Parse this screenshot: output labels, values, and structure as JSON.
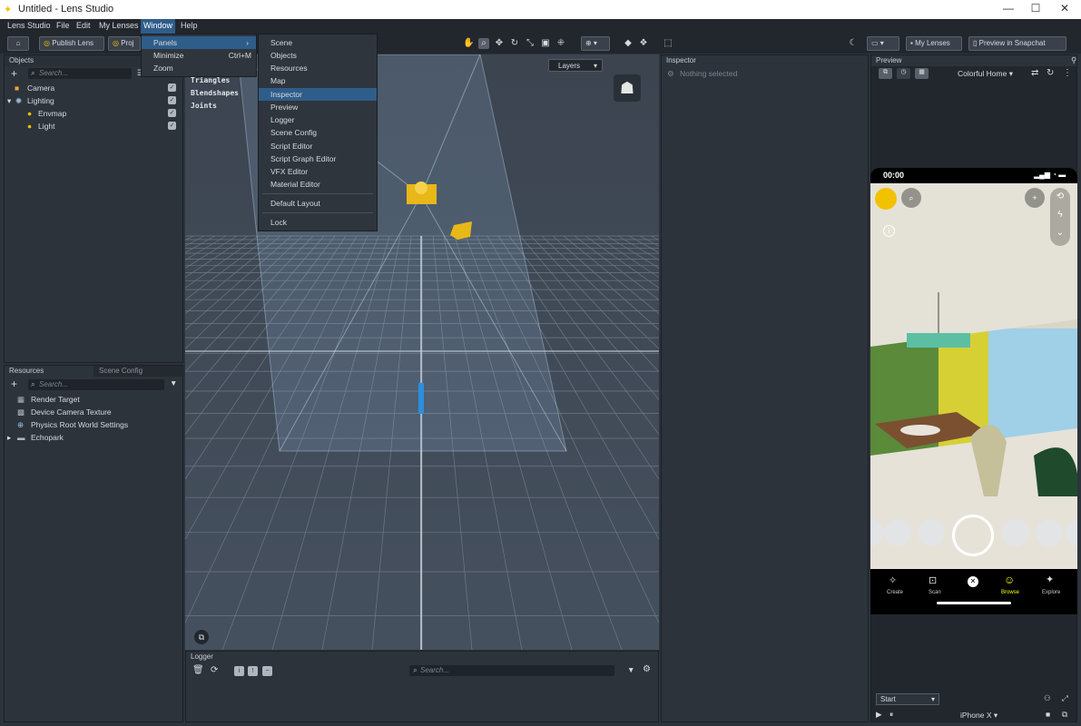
{
  "window": {
    "title": "Untitled - Lens Studio",
    "minimize": "—",
    "maximize": "☐",
    "close": "✕"
  },
  "menubar": [
    "Lens Studio",
    "File",
    "Edit",
    "My Lenses",
    "Window",
    "Help"
  ],
  "toolbar": {
    "publish_label": "Publish Lens",
    "project_label": "Proj",
    "my_lenses_label": "My Lenses",
    "preview_snapchat_label": "Preview in Snapchat"
  },
  "window_menu": {
    "items": [
      {
        "label": "Panels",
        "arrow": "›"
      },
      {
        "label": "Minimize",
        "shortcut": "Ctrl+M"
      },
      {
        "label": "Zoom"
      }
    ]
  },
  "panels_menu": {
    "items": [
      "Scene",
      "Objects",
      "Resources",
      "Map",
      "Inspector",
      "Preview",
      "Logger",
      "Scene Config",
      "Script Editor",
      "Script Graph Editor",
      "VFX Editor",
      "Material Editor",
      "Default Layout",
      "Lock"
    ],
    "highlighted": "Inspector"
  },
  "objects": {
    "title": "Objects",
    "search_placeholder": "Search...",
    "items": [
      {
        "label": "Camera",
        "checked": true
      },
      {
        "label": "Lighting",
        "checked": true
      },
      {
        "label": "Envmap",
        "checked": true
      },
      {
        "label": "Light",
        "checked": true
      }
    ]
  },
  "resources": {
    "tabs": [
      "Resources",
      "Scene Config"
    ],
    "search_placeholder": "Search...",
    "items": [
      "Render Target",
      "Device Camera Texture",
      "Physics Root World Settings",
      "Echopark"
    ]
  },
  "scene": {
    "stats": [
      "Triangles",
      "Blendshapes",
      "Joints"
    ],
    "layers_label": "Layers"
  },
  "inspector": {
    "title": "Inspector",
    "empty_text": "Nothing selected"
  },
  "logger": {
    "title": "Logger",
    "search_placeholder": "Search..."
  },
  "preview": {
    "title": "Preview",
    "scene_select": "Colorful Home",
    "time": "00:00",
    "nav": [
      "Create",
      "Scan",
      "",
      "Browse",
      "Explore"
    ],
    "start_select": "Start",
    "device_select": "iPhone X"
  },
  "colors": {
    "accent": "#2f5d8a",
    "snap_yellow": "#fffc00",
    "bg": "#2d333b"
  }
}
